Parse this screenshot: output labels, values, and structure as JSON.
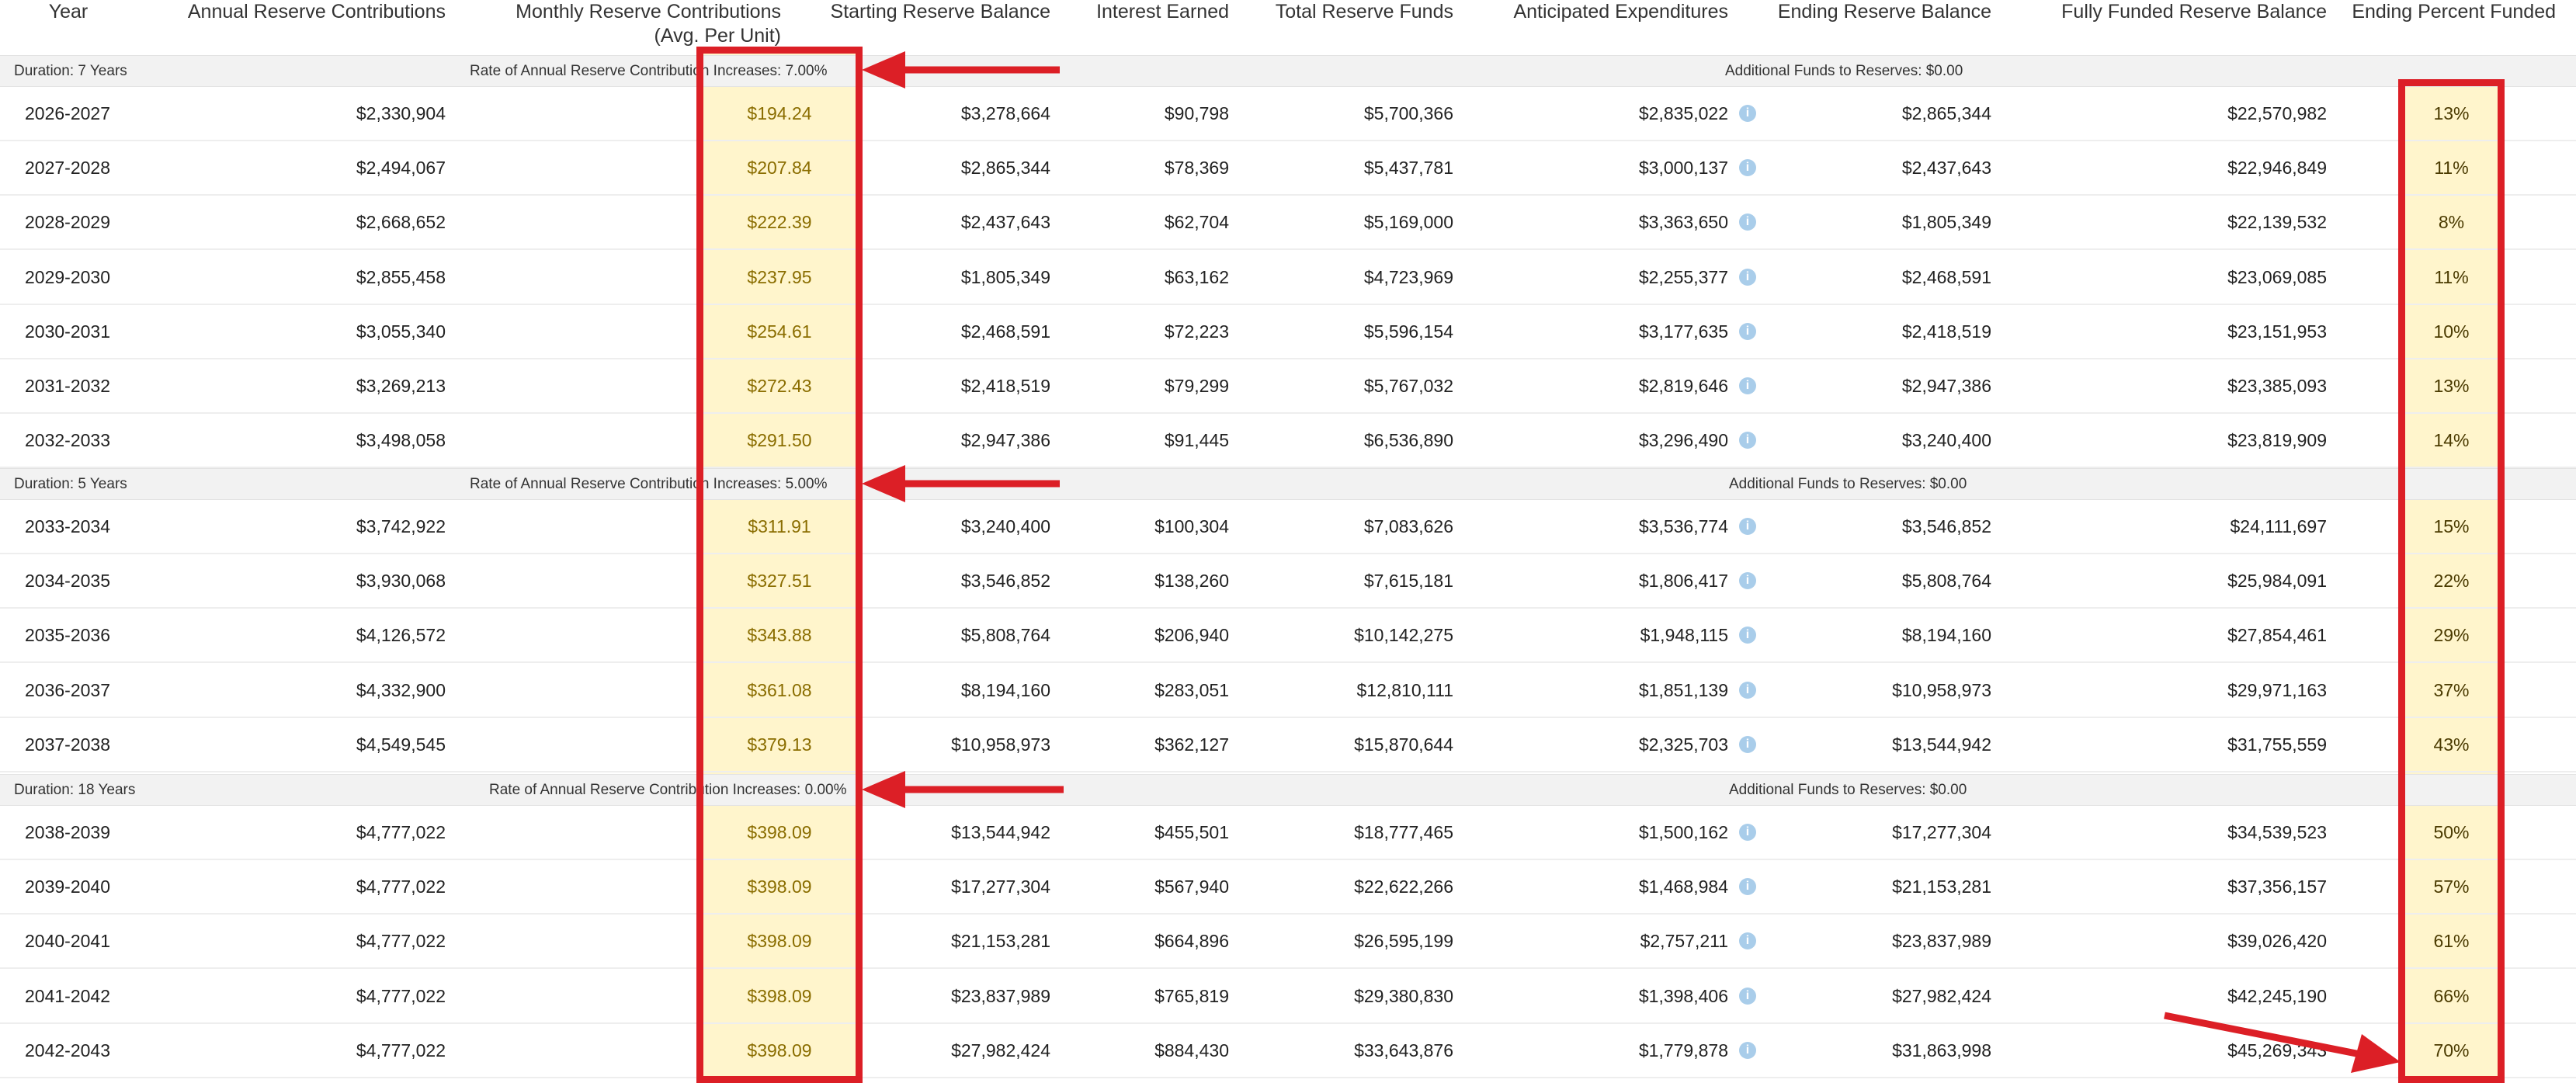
{
  "headers": {
    "year": "Year",
    "annual": "Annual Reserve Contributions",
    "monthly_line1": "Monthly Reserve Contributions",
    "monthly_line2": "(Avg. Per Unit)",
    "starting": "Starting Reserve Balance",
    "interest": "Interest Earned",
    "total": "Total Reserve Funds",
    "expenditures": "Anticipated Expenditures",
    "ending": "Ending Reserve Balance",
    "fully_funded": "Fully Funded Reserve Balance",
    "pct_funded": "Ending Percent Funded"
  },
  "info_icon_glyph": "i",
  "colors": {
    "highlight": "#fff5cc",
    "annotation_red": "#dc1f26",
    "info_icon": "#a9cdea"
  },
  "sections": [
    {
      "duration": "Duration: 7 Years",
      "rate": "Rate of Annual Reserve Contribution Increases: 7.00%",
      "additional": "Additional Funds to Reserves: $0.00",
      "rows": [
        {
          "year": "2026-2027",
          "annual": "$2,330,904",
          "monthly": "$194.24",
          "starting": "$3,278,664",
          "interest": "$90,798",
          "total": "$5,700,366",
          "expenditures": "$2,835,022",
          "ending": "$2,865,344",
          "fully_funded": "$22,570,982",
          "pct": "13%"
        },
        {
          "year": "2027-2028",
          "annual": "$2,494,067",
          "monthly": "$207.84",
          "starting": "$2,865,344",
          "interest": "$78,369",
          "total": "$5,437,781",
          "expenditures": "$3,000,137",
          "ending": "$2,437,643",
          "fully_funded": "$22,946,849",
          "pct": "11%"
        },
        {
          "year": "2028-2029",
          "annual": "$2,668,652",
          "monthly": "$222.39",
          "starting": "$2,437,643",
          "interest": "$62,704",
          "total": "$5,169,000",
          "expenditures": "$3,363,650",
          "ending": "$1,805,349",
          "fully_funded": "$22,139,532",
          "pct": "8%"
        },
        {
          "year": "2029-2030",
          "annual": "$2,855,458",
          "monthly": "$237.95",
          "starting": "$1,805,349",
          "interest": "$63,162",
          "total": "$4,723,969",
          "expenditures": "$2,255,377",
          "ending": "$2,468,591",
          "fully_funded": "$23,069,085",
          "pct": "11%"
        },
        {
          "year": "2030-2031",
          "annual": "$3,055,340",
          "monthly": "$254.61",
          "starting": "$2,468,591",
          "interest": "$72,223",
          "total": "$5,596,154",
          "expenditures": "$3,177,635",
          "ending": "$2,418,519",
          "fully_funded": "$23,151,953",
          "pct": "10%"
        },
        {
          "year": "2031-2032",
          "annual": "$3,269,213",
          "monthly": "$272.43",
          "starting": "$2,418,519",
          "interest": "$79,299",
          "total": "$5,767,032",
          "expenditures": "$2,819,646",
          "ending": "$2,947,386",
          "fully_funded": "$23,385,093",
          "pct": "13%"
        },
        {
          "year": "2032-2033",
          "annual": "$3,498,058",
          "monthly": "$291.50",
          "starting": "$2,947,386",
          "interest": "$91,445",
          "total": "$6,536,890",
          "expenditures": "$3,296,490",
          "ending": "$3,240,400",
          "fully_funded": "$23,819,909",
          "pct": "14%"
        }
      ]
    },
    {
      "duration": "Duration: 5 Years",
      "rate": "Rate of Annual Reserve Contribution Increases: 5.00%",
      "additional": "Additional Funds to Reserves: $0.00",
      "rows": [
        {
          "year": "2033-2034",
          "annual": "$3,742,922",
          "monthly": "$311.91",
          "starting": "$3,240,400",
          "interest": "$100,304",
          "total": "$7,083,626",
          "expenditures": "$3,536,774",
          "ending": "$3,546,852",
          "fully_funded": "$24,111,697",
          "pct": "15%"
        },
        {
          "year": "2034-2035",
          "annual": "$3,930,068",
          "monthly": "$327.51",
          "starting": "$3,546,852",
          "interest": "$138,260",
          "total": "$7,615,181",
          "expenditures": "$1,806,417",
          "ending": "$5,808,764",
          "fully_funded": "$25,984,091",
          "pct": "22%"
        },
        {
          "year": "2035-2036",
          "annual": "$4,126,572",
          "monthly": "$343.88",
          "starting": "$5,808,764",
          "interest": "$206,940",
          "total": "$10,142,275",
          "expenditures": "$1,948,115",
          "ending": "$8,194,160",
          "fully_funded": "$27,854,461",
          "pct": "29%"
        },
        {
          "year": "2036-2037",
          "annual": "$4,332,900",
          "monthly": "$361.08",
          "starting": "$8,194,160",
          "interest": "$283,051",
          "total": "$12,810,111",
          "expenditures": "$1,851,139",
          "ending": "$10,958,973",
          "fully_funded": "$29,971,163",
          "pct": "37%"
        },
        {
          "year": "2037-2038",
          "annual": "$4,549,545",
          "monthly": "$379.13",
          "starting": "$10,958,973",
          "interest": "$362,127",
          "total": "$15,870,644",
          "expenditures": "$2,325,703",
          "ending": "$13,544,942",
          "fully_funded": "$31,755,559",
          "pct": "43%"
        }
      ]
    },
    {
      "duration": "Duration: 18 Years",
      "rate": "Rate of Annual Reserve Contribution Increases: 0.00%",
      "additional": "Additional Funds to Reserves: $0.00",
      "rows": [
        {
          "year": "2038-2039",
          "annual": "$4,777,022",
          "monthly": "$398.09",
          "starting": "$13,544,942",
          "interest": "$455,501",
          "total": "$18,777,465",
          "expenditures": "$1,500,162",
          "ending": "$17,277,304",
          "fully_funded": "$34,539,523",
          "pct": "50%"
        },
        {
          "year": "2039-2040",
          "annual": "$4,777,022",
          "monthly": "$398.09",
          "starting": "$17,277,304",
          "interest": "$567,940",
          "total": "$22,622,266",
          "expenditures": "$1,468,984",
          "ending": "$21,153,281",
          "fully_funded": "$37,356,157",
          "pct": "57%"
        },
        {
          "year": "2040-2041",
          "annual": "$4,777,022",
          "monthly": "$398.09",
          "starting": "$21,153,281",
          "interest": "$664,896",
          "total": "$26,595,199",
          "expenditures": "$2,757,211",
          "ending": "$23,837,989",
          "fully_funded": "$39,026,420",
          "pct": "61%"
        },
        {
          "year": "2041-2042",
          "annual": "$4,777,022",
          "monthly": "$398.09",
          "starting": "$23,837,989",
          "interest": "$765,819",
          "total": "$29,380,830",
          "expenditures": "$1,398,406",
          "ending": "$27,982,424",
          "fully_funded": "$42,245,190",
          "pct": "66%"
        },
        {
          "year": "2042-2043",
          "annual": "$4,777,022",
          "monthly": "$398.09",
          "starting": "$27,982,424",
          "interest": "$884,430",
          "total": "$33,643,876",
          "expenditures": "$1,779,878",
          "ending": "$31,863,998",
          "fully_funded": "$45,269,343",
          "pct": "70%"
        }
      ]
    }
  ]
}
